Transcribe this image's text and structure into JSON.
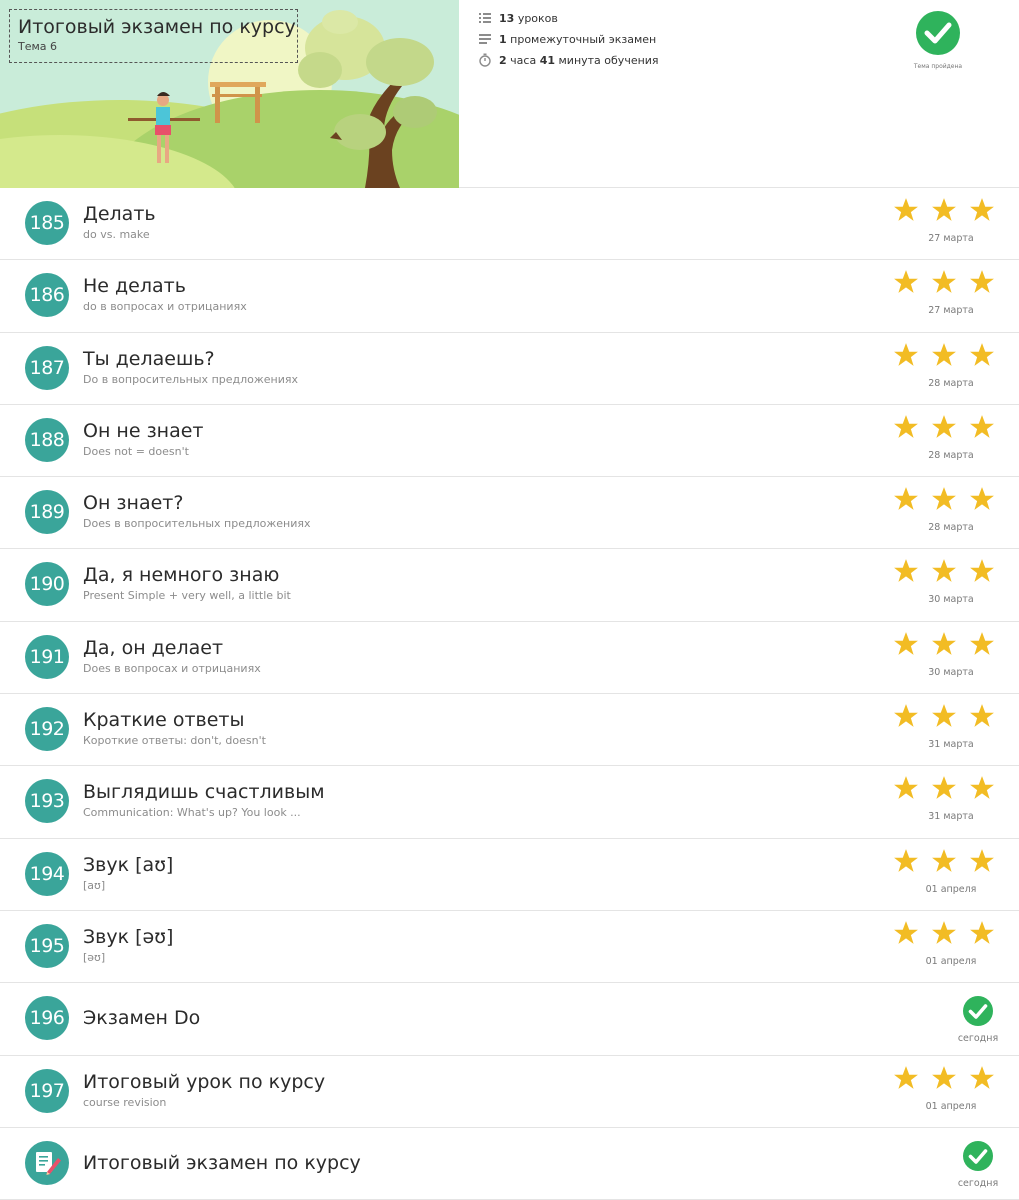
{
  "header": {
    "title": "Итоговый экзамен по курсу",
    "subtitle": "Тема 6",
    "meta": {
      "lessons_count": "13",
      "lessons_label": "уроков",
      "exams_count": "1",
      "exams_label": "промежуточный экзамен",
      "hours": "2",
      "hours_label": "часа",
      "minutes": "41",
      "minutes_label": "минута обучения"
    },
    "passed_label": "Тема пройдена"
  },
  "lessons": [
    {
      "num": "185",
      "title": "Делать",
      "sub": "do vs. make",
      "stars": 3,
      "date": "27 марта"
    },
    {
      "num": "186",
      "title": "Не делать",
      "sub": "do в вопросах и отрицаниях",
      "stars": 3,
      "date": "27 марта"
    },
    {
      "num": "187",
      "title": "Ты делаешь?",
      "sub": "Do в вопросительных предложениях",
      "stars": 3,
      "date": "28 марта"
    },
    {
      "num": "188",
      "title": "Он не знает",
      "sub": "Does not = doesn't",
      "stars": 3,
      "date": "28 марта"
    },
    {
      "num": "189",
      "title": "Он знает?",
      "sub": "Does в вопросительных предложениях",
      "stars": 3,
      "date": "28 марта"
    },
    {
      "num": "190",
      "title": "Да, я немного знаю",
      "sub": "Present Simple + very well, a little bit",
      "stars": 3,
      "date": "30 марта"
    },
    {
      "num": "191",
      "title": "Да, он делает",
      "sub": "Does в вопросах и отрицаниях",
      "stars": 3,
      "date": "30 марта"
    },
    {
      "num": "192",
      "title": "Краткие ответы",
      "sub": "Короткие ответы: don't, doesn't",
      "stars": 3,
      "date": "31 марта"
    },
    {
      "num": "193",
      "title": "Выглядишь счастливым",
      "sub": "Communication: What's up? You look ...",
      "stars": 3,
      "date": "31 марта"
    },
    {
      "num": "194",
      "title": "Звук [aʊ]",
      "sub": "[aʊ]",
      "stars": 3,
      "date": "01 апреля"
    },
    {
      "num": "195",
      "title": "Звук [əʊ]",
      "sub": "[əʊ]",
      "stars": 3,
      "date": "01 апреля"
    },
    {
      "num": "196",
      "title": "Экзамен Do",
      "sub": "",
      "check": true,
      "date": "сегодня"
    },
    {
      "num": "197",
      "title": "Итоговый урок по курсу",
      "sub": "course revision",
      "stars": 3,
      "date": "01 апреля"
    },
    {
      "num": "",
      "title": "Итоговый экзамен по курсу",
      "sub": "",
      "check": true,
      "exam_icon": "exam-pencil-icon",
      "date": "сегодня"
    }
  ],
  "colors": {
    "accent": "#3aa59a",
    "star": "#f2bc24",
    "success": "#2fb35c"
  }
}
